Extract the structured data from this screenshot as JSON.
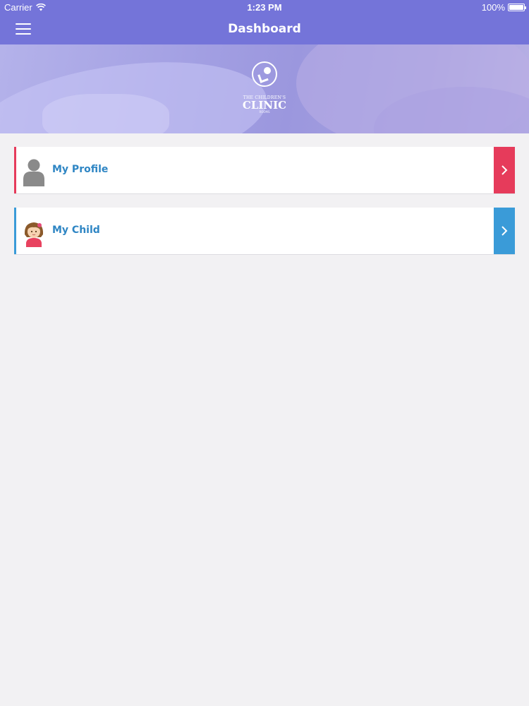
{
  "status_bar": {
    "carrier": "Carrier",
    "time": "1:23 PM",
    "battery": "100%",
    "icons": [
      "wifi-icon",
      "battery-icon"
    ]
  },
  "navbar": {
    "title": "Dashboard",
    "menu_icon": "hamburger-menu-icon"
  },
  "hero": {
    "logo": {
      "line1": "THE CHILDREN'S",
      "line2": "CLINIC",
      "line3": "ROOMS"
    }
  },
  "menu_items": [
    {
      "label": "My Profile",
      "icon": "user-silhouette-icon",
      "accent": "#e63b5b"
    },
    {
      "label": "My Child",
      "icon": "child-girl-icon",
      "accent": "#3a9bd8"
    }
  ],
  "colors": {
    "header": "#7474d9",
    "background": "#f2f1f3",
    "label": "#2f86c4"
  }
}
